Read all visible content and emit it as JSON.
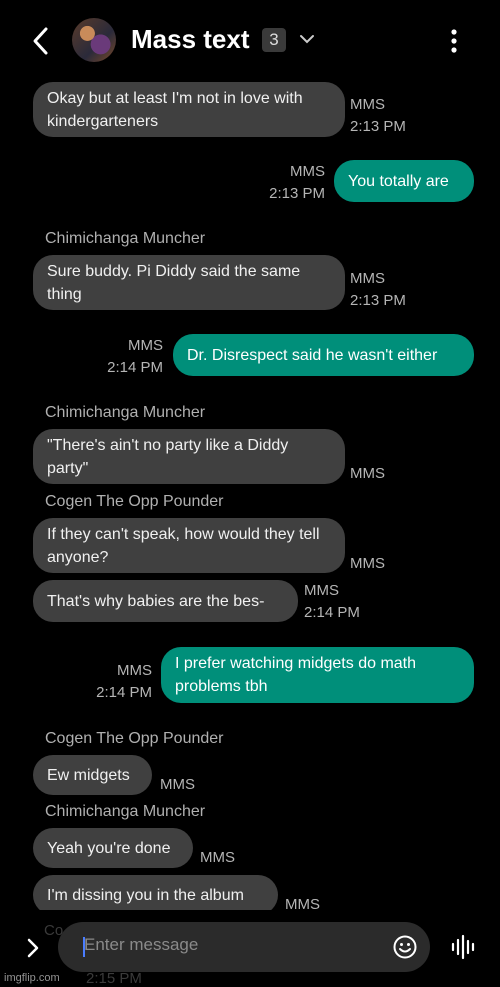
{
  "header": {
    "title": "Mass text",
    "member_count": "3"
  },
  "messages": [
    {
      "dir": "in",
      "text": "Okay but at least I'm not in love with kindergarteners",
      "type": "MMS",
      "time": "2:13 PM"
    },
    {
      "dir": "out",
      "text": "You totally are",
      "type": "MMS",
      "time": "2:13 PM"
    },
    {
      "dir": "in",
      "sender": "Chimichanga Muncher",
      "text": "Sure buddy. Pi Diddy said the same thing",
      "type": "MMS",
      "time": "2:13 PM"
    },
    {
      "dir": "out",
      "text": "Dr. Disrespect said he wasn't either",
      "type": "MMS",
      "time": "2:14 PM"
    },
    {
      "dir": "in",
      "sender": "Chimichanga Muncher",
      "text": "\"There's ain't no party like a Diddy party\"",
      "type": "MMS"
    },
    {
      "dir": "in",
      "sender": "Cogen The Opp Pounder",
      "text": "If they can't speak, how would they tell anyone?",
      "type": "MMS"
    },
    {
      "dir": "in",
      "text": "That's why babies are the bes-",
      "type": "MMS",
      "time": "2:14 PM"
    },
    {
      "dir": "out",
      "text": "I prefer watching midgets do math problems tbh",
      "type": "MMS",
      "time": "2:14 PM"
    },
    {
      "dir": "in",
      "sender": "Cogen The Opp Pounder",
      "text": "Ew midgets",
      "type": "MMS"
    },
    {
      "dir": "in",
      "sender": "Chimichanga Muncher",
      "text": "Yeah you're done",
      "type": "MMS"
    },
    {
      "dir": "in",
      "text": "I'm dissing you in the album",
      "type": "MMS"
    }
  ],
  "peek": {
    "sender_partial": "Co",
    "time_partial": "2:15 PM"
  },
  "composer": {
    "placeholder": "Enter message"
  },
  "watermark": "imgflip.com",
  "colors": {
    "incoming": "#404040",
    "outgoing": "#008f7a",
    "background": "#000000"
  },
  "icons": [
    "back-arrow-icon",
    "chevron-down-icon",
    "more-vert-icon",
    "expand-icon",
    "emoji-icon",
    "voice-icon"
  ]
}
